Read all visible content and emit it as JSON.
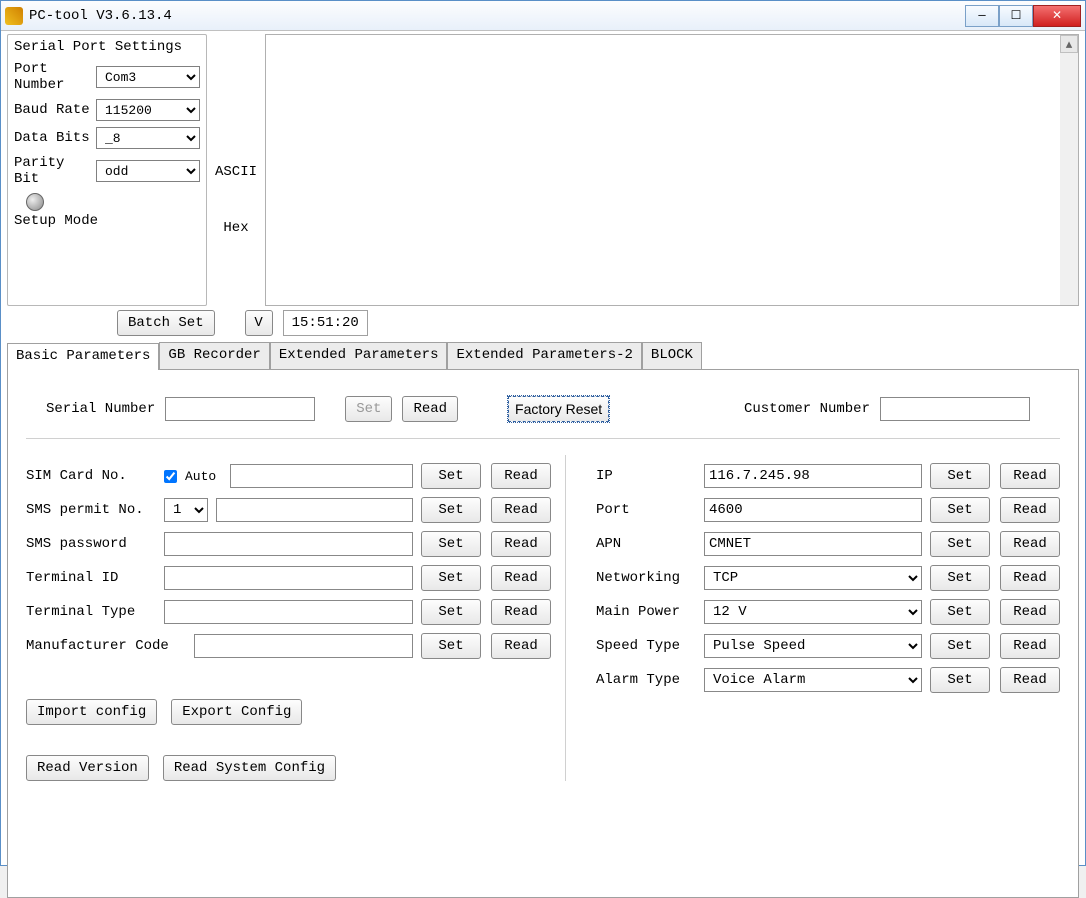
{
  "window": {
    "title": "PC-tool V3.6.13.4"
  },
  "serial": {
    "legend": "Serial Port Settings",
    "port_label": "Port Number",
    "port_value": "Com3",
    "baud_label": "Baud Rate",
    "baud_value": "115200",
    "data_label": "Data Bits",
    "data_value": "_8",
    "parity_label": "Parity Bit",
    "parity_value": "odd",
    "mode_label": "Setup Mode"
  },
  "mid": {
    "ascii": "ASCII",
    "hex": "Hex"
  },
  "under": {
    "batch_set": "Batch Set",
    "v": "V",
    "time": "15:51:20"
  },
  "tabs": [
    "Basic Parameters",
    "GB Recorder",
    "Extended Parameters",
    "Extended Parameters-2",
    "BLOCK"
  ],
  "top": {
    "serial_number_label": "Serial Number",
    "set": "Set",
    "read": "Read",
    "factory_reset": "Factory Reset",
    "customer_number_label": "Customer Number"
  },
  "left": {
    "sim_label": "SIM Card No.",
    "auto": "Auto",
    "sms_permit_label": "SMS permit No.",
    "sms_permit_value": "1",
    "sms_password_label": "SMS password",
    "terminal_id_label": "Terminal ID",
    "terminal_type_label": "Terminal Type",
    "manufacturer_label": "Manufacturer Code"
  },
  "right": {
    "ip_label": "IP",
    "ip_value": "116.7.245.98",
    "port_label": "Port",
    "port_value": "4600",
    "apn_label": "APN",
    "apn_value": "CMNET",
    "net_label": "Networking",
    "net_value": "TCP",
    "main_power_label": "Main Power",
    "main_power_value": "12 V",
    "speed_type_label": "Speed Type",
    "speed_type_value": "Pulse Speed",
    "alarm_type_label": "Alarm Type",
    "alarm_type_value": "Voice Alarm"
  },
  "bottom": {
    "import": "Import config",
    "export": "Export Config",
    "read_version": "Read Version",
    "read_system": "Read System Config"
  },
  "common": {
    "set": "Set",
    "read": "Read"
  }
}
